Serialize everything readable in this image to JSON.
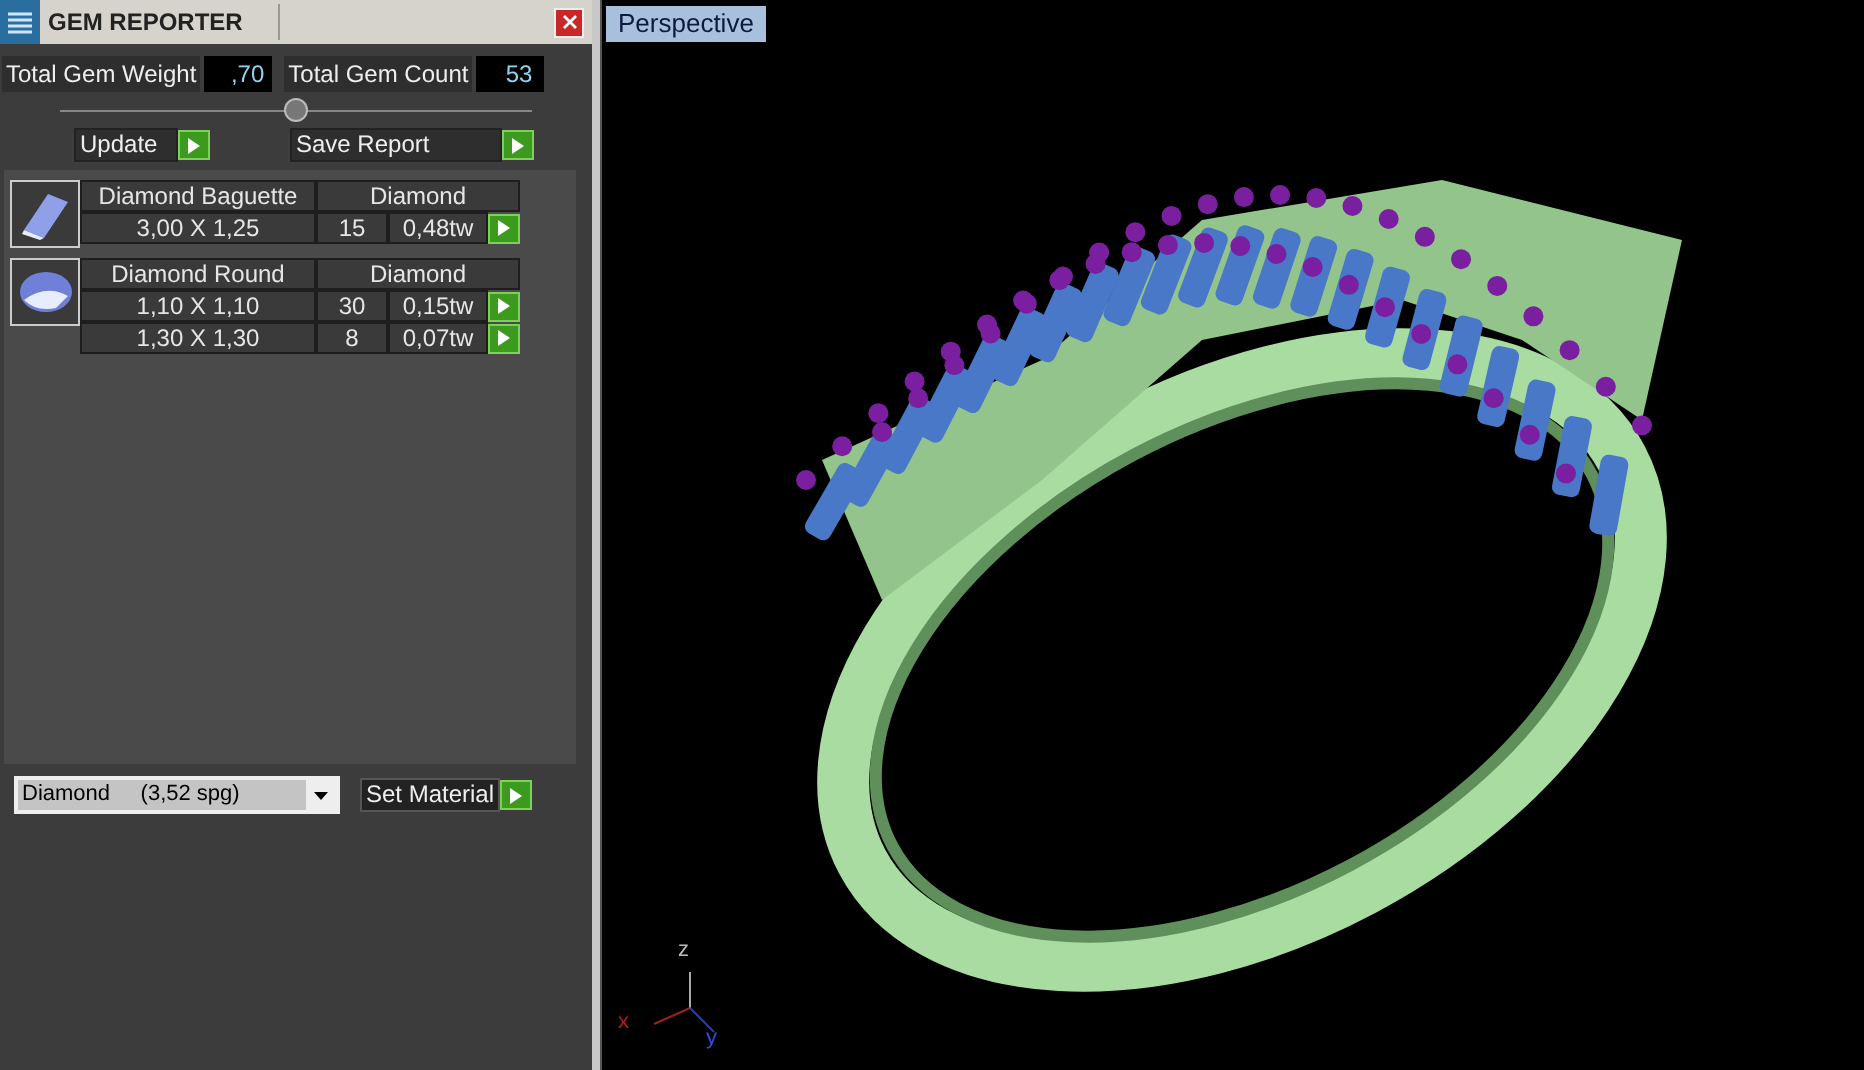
{
  "panel": {
    "title": "GEM REPORTER",
    "total_weight_label": "Total Gem Weight",
    "total_weight": ",70",
    "total_count_label": "Total Gem Count",
    "total_count": "53",
    "buttons": [
      "Update",
      "Save Report"
    ],
    "slider": {
      "level": 0.5
    }
  },
  "gems": [
    {
      "kind": "baguette",
      "name": "Diamond Baguette",
      "material": "Diamond",
      "rows": [
        {
          "size": "3,00 X 1,25",
          "count": "15",
          "weight": "0,48tw"
        }
      ]
    },
    {
      "kind": "round",
      "name": "Diamond Round",
      "material": "Diamond",
      "rows": [
        {
          "size": "1,10 X 1,10",
          "count": "30",
          "weight": "0,15tw"
        },
        {
          "size": "1,30 X 1,30",
          "count": "8",
          "weight": "0,07tw"
        }
      ]
    }
  ],
  "material_select": {
    "value": "Diamond     (3,52 spg)",
    "button": "Set Material"
  },
  "viewport": {
    "label": "Perspective",
    "axes": [
      "z",
      "x",
      "y"
    ]
  }
}
